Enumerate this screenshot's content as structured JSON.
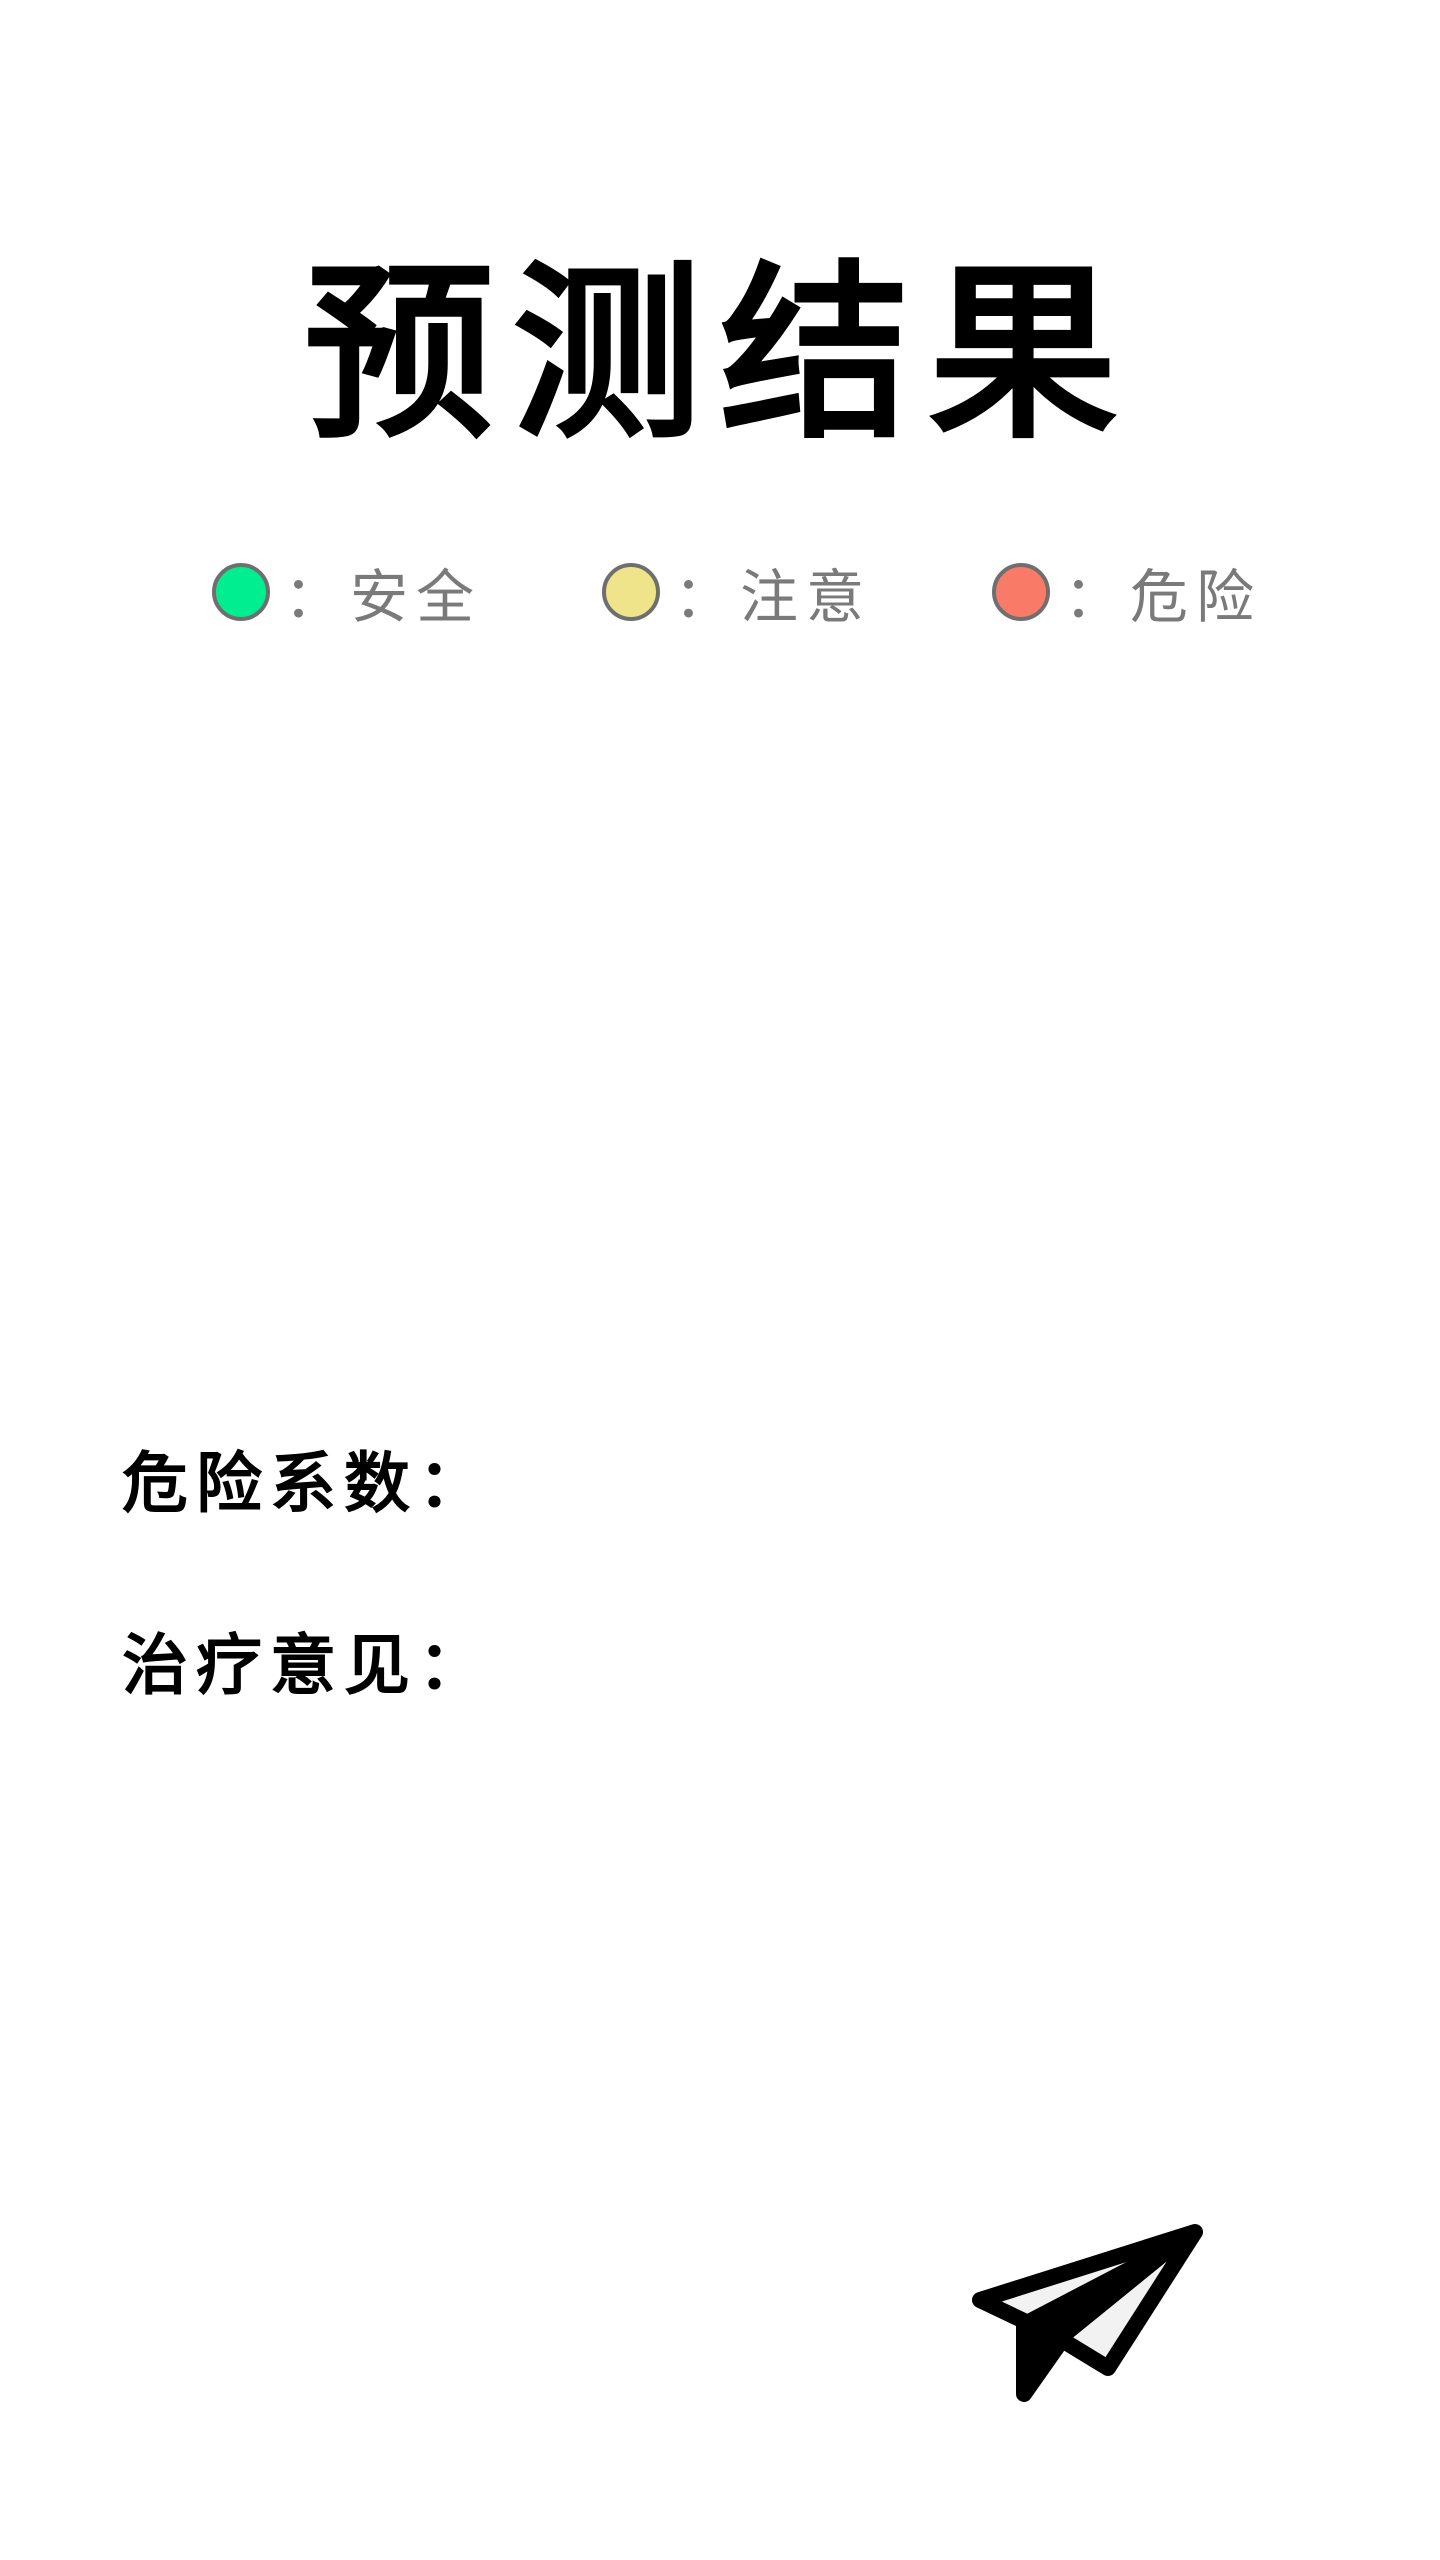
{
  "header": {
    "title": "预测结果"
  },
  "legend": {
    "items": [
      {
        "key": "safe",
        "label": "：安全",
        "color": "#00ee8f"
      },
      {
        "key": "caution",
        "label": "：注意",
        "color": "#efe48a"
      },
      {
        "key": "danger",
        "label": "：危险",
        "color": "#fa7a68"
      }
    ]
  },
  "result": {
    "risk_label": "危险系数：",
    "risk_value": "",
    "treatment_label": "治疗意见：",
    "treatment_value": ""
  },
  "actions": {
    "send_icon": "paper-plane-icon"
  }
}
